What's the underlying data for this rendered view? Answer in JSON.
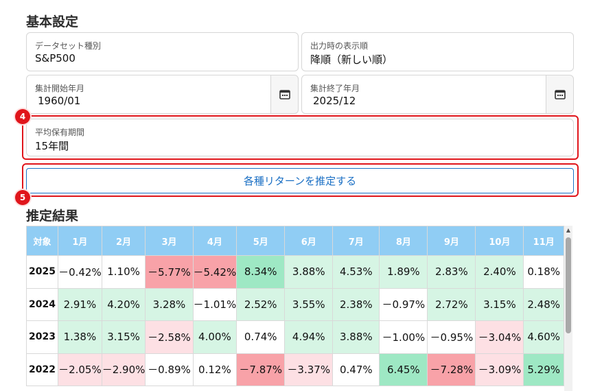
{
  "sections": {
    "basic_title": "基本設定",
    "result_title": "推定結果"
  },
  "fields": {
    "dataset": {
      "label": "データセット種別",
      "value": "S&P500"
    },
    "order": {
      "label": "出力時の表示順",
      "value": "降順（新しい順）"
    },
    "start": {
      "label": "集計開始年月",
      "value": "1960/01"
    },
    "end": {
      "label": "集計終了年月",
      "value": "2025/12"
    },
    "holding": {
      "label": "平均保有期間",
      "value": "15年間"
    }
  },
  "callouts": {
    "four": "4",
    "five": "5"
  },
  "run_button": "各種リターンを推定する",
  "icons": {
    "calendar": "calendar-icon",
    "scroll_up": "chevron-up-icon"
  },
  "colors": {
    "header_bg": "#90cdf4",
    "positive_light": "#d6f5e4",
    "positive_strong": "#9ee8c4",
    "negative_light": "#fde0e4",
    "negative_strong": "#f8a2a8",
    "accent": "#1a73c7",
    "callout": "#e0151b"
  },
  "table": {
    "headers": [
      "対象",
      "1月",
      "2月",
      "3月",
      "4月",
      "5月",
      "6月",
      "7月",
      "8月",
      "9月",
      "10月",
      "11月"
    ],
    "rows": [
      {
        "year": "2025",
        "cells": [
          {
            "v": "－0.42%",
            "t": "n"
          },
          {
            "v": "1.10%",
            "t": "n"
          },
          {
            "v": "－5.77%",
            "t": "neg2"
          },
          {
            "v": "－5.42%",
            "t": "neg2"
          },
          {
            "v": "8.34%",
            "t": "pos2"
          },
          {
            "v": "3.88%",
            "t": "pos1"
          },
          {
            "v": "4.53%",
            "t": "pos1"
          },
          {
            "v": "1.89%",
            "t": "pos1"
          },
          {
            "v": "2.83%",
            "t": "pos1"
          },
          {
            "v": "2.40%",
            "t": "pos1"
          },
          {
            "v": "0.18%",
            "t": "n"
          }
        ]
      },
      {
        "year": "2024",
        "cells": [
          {
            "v": "2.91%",
            "t": "pos1"
          },
          {
            "v": "4.20%",
            "t": "pos1"
          },
          {
            "v": "3.28%",
            "t": "pos1"
          },
          {
            "v": "－1.01%",
            "t": "n"
          },
          {
            "v": "2.52%",
            "t": "pos1"
          },
          {
            "v": "3.55%",
            "t": "pos1"
          },
          {
            "v": "2.38%",
            "t": "pos1"
          },
          {
            "v": "－0.97%",
            "t": "n"
          },
          {
            "v": "2.72%",
            "t": "pos1"
          },
          {
            "v": "3.15%",
            "t": "pos1"
          },
          {
            "v": "2.48%",
            "t": "pos1"
          }
        ]
      },
      {
        "year": "2023",
        "cells": [
          {
            "v": "1.38%",
            "t": "pos1"
          },
          {
            "v": "3.15%",
            "t": "pos1"
          },
          {
            "v": "－2.58%",
            "t": "neg1"
          },
          {
            "v": "4.00%",
            "t": "pos1"
          },
          {
            "v": "0.74%",
            "t": "n"
          },
          {
            "v": "4.94%",
            "t": "pos1"
          },
          {
            "v": "3.88%",
            "t": "pos1"
          },
          {
            "v": "－1.00%",
            "t": "n"
          },
          {
            "v": "－0.95%",
            "t": "n"
          },
          {
            "v": "－3.04%",
            "t": "neg1"
          },
          {
            "v": "4.60%",
            "t": "pos1"
          }
        ]
      },
      {
        "year": "2022",
        "cells": [
          {
            "v": "－2.05%",
            "t": "neg1"
          },
          {
            "v": "－2.90%",
            "t": "neg1"
          },
          {
            "v": "－0.89%",
            "t": "n"
          },
          {
            "v": "0.12%",
            "t": "n"
          },
          {
            "v": "－7.87%",
            "t": "neg2"
          },
          {
            "v": "－3.37%",
            "t": "neg1"
          },
          {
            "v": "0.47%",
            "t": "n"
          },
          {
            "v": "6.45%",
            "t": "pos2"
          },
          {
            "v": "－7.28%",
            "t": "neg2"
          },
          {
            "v": "－3.09%",
            "t": "neg1"
          },
          {
            "v": "5.29%",
            "t": "pos2"
          }
        ]
      }
    ]
  }
}
